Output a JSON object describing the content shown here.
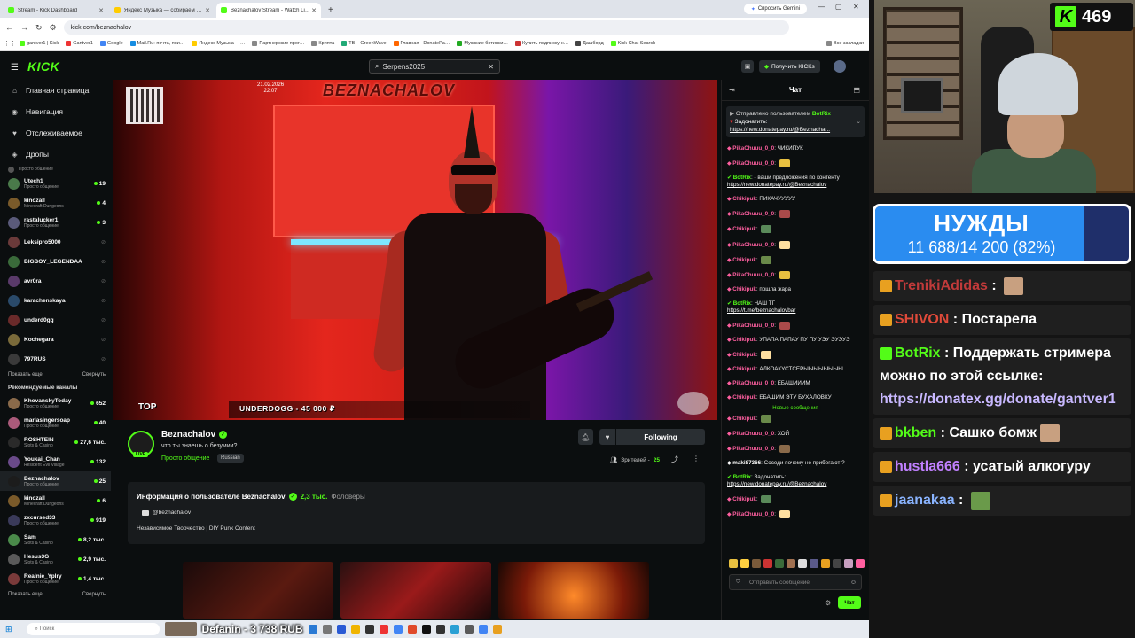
{
  "browser": {
    "tabs": [
      {
        "label": "Stream - Kick Dashboard",
        "color": "#53fc18",
        "active": false
      },
      {
        "label": "Яндекс Музыка — собираем …",
        "color": "#ffcc00",
        "active": false
      },
      {
        "label": "Beznachalov Stream - Watch Li…",
        "color": "#53fc18",
        "active": true
      }
    ],
    "gemini_label": "Спросить Gemini",
    "url": "kick.com/beznachalov",
    "bookmarks": [
      "gantver1 | Kick",
      "Gantver1",
      "Google",
      "Mail.Ru: почта, пои…",
      "Яндекс Музыка —…",
      "Партнерские прог…",
      "Крипта",
      "TB – GreenWave",
      "Главная - DonatePa…",
      "Мужские ботинки…",
      "Купить подписку н…",
      "Дашборд",
      "Kick Chat Search"
    ],
    "all_bookmarks": "Все закладки"
  },
  "kick": {
    "search_value": "Serpens2025",
    "get_kicks": "Получить KICKs",
    "nav": [
      {
        "icon": "home-icon",
        "glyph": "⌂",
        "label": "Главная страница"
      },
      {
        "icon": "compass-icon",
        "glyph": "◉",
        "label": "Навигация"
      },
      {
        "icon": "heart-icon",
        "glyph": "♥",
        "label": "Отслеживаемое"
      },
      {
        "icon": "drops-icon",
        "glyph": "◈",
        "label": "Дропы"
      }
    ],
    "followed_partial": "Просто общение",
    "followed": [
      {
        "name": "Utech1",
        "game": "Просто общение",
        "viewers": "19",
        "color": "#4a7a4a"
      },
      {
        "name": "kinozall",
        "game": "Minecraft Dungeons",
        "viewers": "4",
        "color": "#7a5a2a"
      },
      {
        "name": "rastalucker1",
        "game": "Просто общение",
        "viewers": "3",
        "color": "#5a5a7a"
      },
      {
        "name": "Leksipro5000",
        "game": "",
        "viewers": "",
        "color": "#6a3a3a"
      },
      {
        "name": "BIGBOY_LEGENDAA",
        "game": "",
        "viewers": "",
        "color": "#3a6a3a"
      },
      {
        "name": "avr0ra",
        "game": "",
        "viewers": "",
        "color": "#5a3a6a"
      },
      {
        "name": "karachenskaya",
        "game": "",
        "viewers": "",
        "color": "#2a4a6a"
      },
      {
        "name": "underd0gg",
        "game": "",
        "viewers": "",
        "color": "#6a2a2a"
      },
      {
        "name": "Kochegara",
        "game": "",
        "viewers": "",
        "color": "#7a6a3a"
      },
      {
        "name": "797RUS",
        "game": "",
        "viewers": "",
        "color": "#3a3a3a"
      }
    ],
    "show_more": "Показать еще",
    "collapse": "Свернуть",
    "recommended_title": "Рекомендуемые каналы",
    "recommended": [
      {
        "name": "KhovanskyToday",
        "game": "Просто общение",
        "viewers": "652",
        "color": "#8a6a4a"
      },
      {
        "name": "marlasingersoap",
        "game": "Просто общение",
        "viewers": "40",
        "color": "#aa5a7a"
      },
      {
        "name": "ROSHTEIN",
        "game": "Slots & Casino",
        "viewers": "27,6 тыс.",
        "color": "#2a2a2a"
      },
      {
        "name": "Youkai_Chan",
        "game": "Resident Evil Village",
        "viewers": "132",
        "color": "#6a4a8a"
      },
      {
        "name": "Beznachalov",
        "game": "Просто общение",
        "viewers": "25",
        "color": "#1c1c1c"
      },
      {
        "name": "kinozall",
        "game": "Minecraft Dungeons",
        "viewers": "6",
        "color": "#7a5a2a"
      },
      {
        "name": "zxcursed33",
        "game": "Просто общение",
        "viewers": "919",
        "color": "#3a3a5a"
      },
      {
        "name": "Sam",
        "game": "Slots & Casino",
        "viewers": "8,2 тыс.",
        "color": "#4a8a4a"
      },
      {
        "name": "Hesus3G",
        "game": "Slots & Casino",
        "viewers": "2,9 тыс.",
        "color": "#5a5a5a"
      },
      {
        "name": "Realnie_Yplry",
        "game": "Просто общение",
        "viewers": "1,4 тыс.",
        "color": "#7a3a3a"
      }
    ],
    "video": {
      "date": "21.02.2026",
      "time": "22:07",
      "banner": "BEZNACHALOV",
      "top_label": "TOP",
      "underdog": "UNDERDOGG - 45 000 ₽"
    },
    "stream": {
      "channel": "Beznachalov",
      "title": "что ты знаешь о безумии?",
      "category": "Просто общение",
      "language": "Russian",
      "live": "LIVE",
      "follow_label": "Following",
      "viewers_label": "Зрителей -",
      "viewers": "25"
    },
    "about": {
      "title": "Информация о пользователе Beznachalov",
      "followers": "2,3 тыс.",
      "followers_label": "Фоловеры",
      "youtube": "@beznachalov",
      "description": "Независимое Творчество | DIY Punk Content"
    },
    "chat": {
      "title": "Чат",
      "pinned_by": "Отправлено пользователем",
      "pinned_user": "BotRix",
      "pinned_text": "Задонатить:",
      "pinned_link": "https://new.donatepay.ru/@Beznacha...",
      "new_messages": "Новые сообщения",
      "messages_before": [
        {
          "user": "PikaChuuu_0_0",
          "color": "#ff5fa0",
          "text": "ЧИКИПУК",
          "link": "",
          "emote": false
        },
        {
          "user": "PikaChuuu_0_0",
          "color": "#ff5fa0",
          "text": "",
          "link": "",
          "emote": true
        },
        {
          "user": "BotRix",
          "color": "#53fc18",
          "text": "- ваши предложения по контенту",
          "link": "https://new.donatepay.ru/@Beznachalov",
          "emote": false
        },
        {
          "user": "Chikipuk",
          "color": "#ff5fa0",
          "text": "ПИКАЧУУУУУ",
          "link": "",
          "emote": false
        },
        {
          "user": "PikaChuuu_0_0",
          "color": "#ff5fa0",
          "text": "",
          "link": "",
          "emote": true
        },
        {
          "user": "Chikipuk",
          "color": "#ff5fa0",
          "text": "",
          "link": "",
          "emote": true
        },
        {
          "user": "PikaChuuu_0_0",
          "color": "#ff5fa0",
          "text": "",
          "link": "",
          "emote": true
        },
        {
          "user": "Chikipuk",
          "color": "#ff5fa0",
          "text": "",
          "link": "",
          "emote": true
        },
        {
          "user": "PikaChuuu_0_0",
          "color": "#ff5fa0",
          "text": "",
          "link": "",
          "emote": true
        },
        {
          "user": "Chikipuk",
          "color": "#ff5fa0",
          "text": "пошла жара",
          "link": "",
          "emote": false
        },
        {
          "user": "BotRix",
          "color": "#53fc18",
          "text": "НАШ ТГ",
          "link": "https://t.me/beznachalovbar",
          "emote": false
        },
        {
          "user": "PikaChuuu_0_0",
          "color": "#ff5fa0",
          "text": "",
          "link": "",
          "emote": true
        },
        {
          "user": "Chikipuk",
          "color": "#ff5fa0",
          "text": "УПАПА ПАПАУ ПУ ПУ УЭУ ЭУЭУЭ",
          "link": "",
          "emote": false
        },
        {
          "user": "Chikipuk",
          "color": "#ff5fa0",
          "text": "",
          "link": "",
          "emote": true
        },
        {
          "user": "Chikipuk",
          "color": "#ff5fa0",
          "text": "АЛКОАКУСТСЕРЫЫЫЫЫЫЫЫ",
          "link": "",
          "emote": false
        },
        {
          "user": "PikaChuuu_0_0",
          "color": "#ff5fa0",
          "text": "ЕБАШИИИМ",
          "link": "",
          "emote": false
        },
        {
          "user": "Chikipuk",
          "color": "#ff5fa0",
          "text": "ЕБАШИМ ЭТУ БУХАЛОВКУ",
          "link": "",
          "emote": false
        }
      ],
      "messages_after": [
        {
          "user": "Chikipuk",
          "color": "#ff5fa0",
          "text": "",
          "link": "",
          "emote": true
        },
        {
          "user": "PikaChuuu_0_0",
          "color": "#ff5fa0",
          "text": "ХОЙ",
          "link": "",
          "emote": false
        },
        {
          "user": "PikaChuuu_0_0",
          "color": "#ff5fa0",
          "text": "",
          "link": "",
          "emote": true
        },
        {
          "user": "maki87366",
          "color": "#ffffff",
          "text": "Соседи почему не прибегают ?",
          "link": "",
          "emote": false
        },
        {
          "user": "BotRix",
          "color": "#53fc18",
          "text": "Задонатить:",
          "link": "https://new.donatepay.ru/@Beznachalov",
          "emote": false
        },
        {
          "user": "Chikipuk",
          "color": "#ff5fa0",
          "text": "",
          "link": "",
          "emote": true
        },
        {
          "user": "PikaChuuu_0_0",
          "color": "#ff5fa0",
          "text": "",
          "link": "",
          "emote": true
        }
      ],
      "input_placeholder": "Отправить сообщение",
      "send_label": "Чат"
    }
  },
  "taskbar": {
    "search_placeholder": "Поиск",
    "now_playing": "Defanin - 3 738 RUB"
  },
  "overlay": {
    "kick_count": "469",
    "goal_title": "НУЖДЫ",
    "goal_value": "11 688/14 200 (82%)",
    "goal_progress": 0.82,
    "messages": [
      {
        "user": "TrenikiAdidas",
        "color": "#c03a3a",
        "text": "",
        "emote": true
      },
      {
        "user": "SHIVON",
        "color": "#e04a3a",
        "text": "Постарела",
        "emote": false
      },
      {
        "user": "BotRix",
        "color": "#53fc18",
        "text": "Поддержать стримера можно по этой ссылке:",
        "link": "https://donatex.gg/donate/gantver1",
        "emote": false
      },
      {
        "user": "bkben",
        "color": "#53fc18",
        "text": "Сашко бомж",
        "emote": true
      },
      {
        "user": "hustla666",
        "color": "#c080ff",
        "text": "усатый алкогуру",
        "emote": false
      },
      {
        "user": "jaanakaa",
        "color": "#8ab4ff",
        "text": "",
        "emote": true
      }
    ]
  }
}
